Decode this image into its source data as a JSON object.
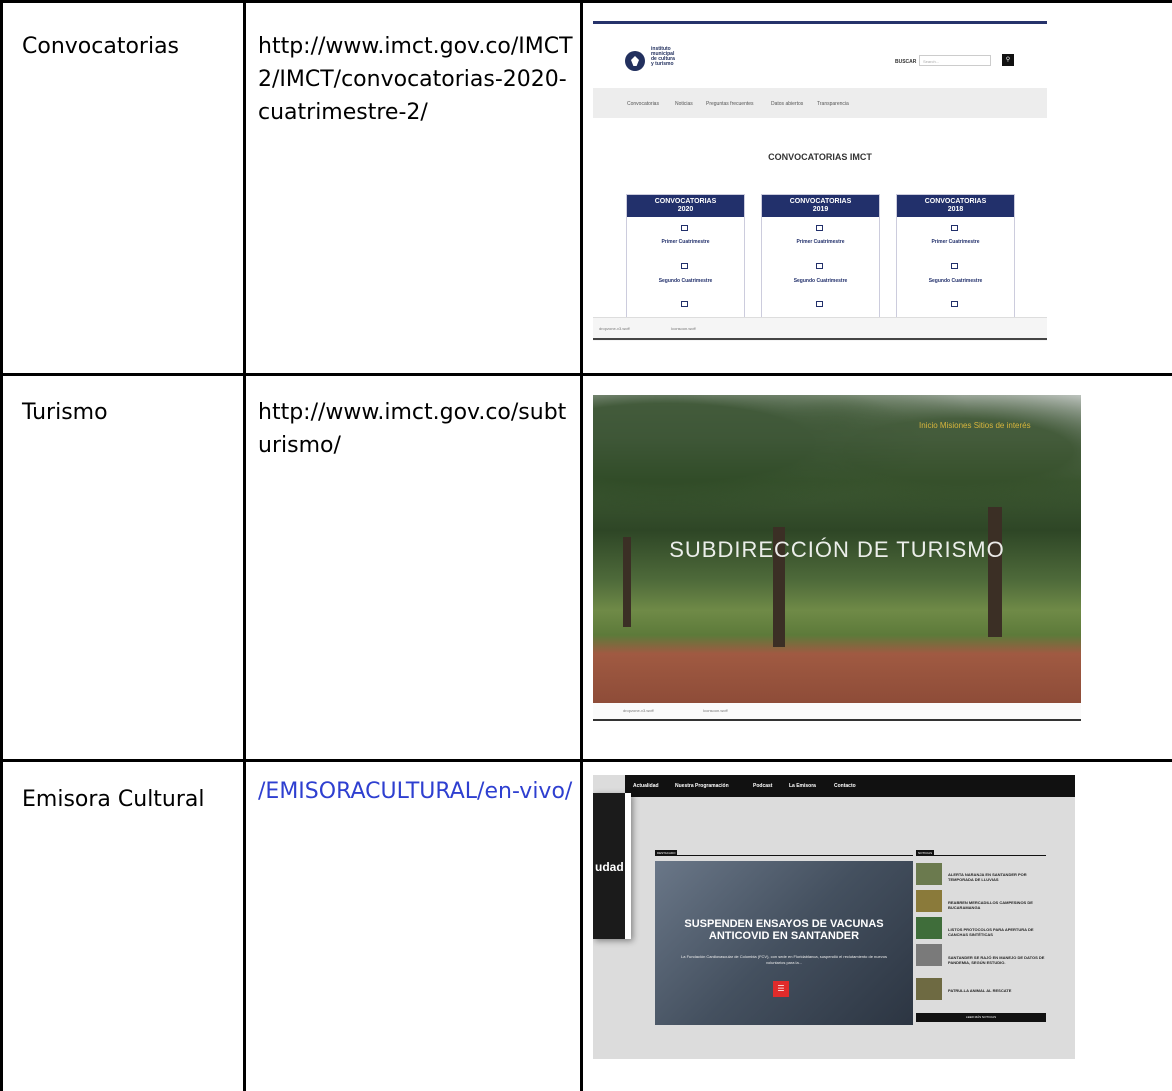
{
  "rows": [
    {
      "name": "Convocatorias",
      "url": "http://www.imct.gov.co/IMCT2/IMCT/convocatorias-2020-cuatrimestre-2/",
      "url_is_link": false
    },
    {
      "name": "Turismo",
      "url": "http://www.imct.gov.co/subturismo/",
      "url_is_link": false
    },
    {
      "name": "Emisora Cultural",
      "url": "/EMISORACULTURAL/en-vivo/",
      "url_is_link": true
    }
  ],
  "shot1": {
    "logo_lines": [
      "instituto",
      "municipal",
      "de cultura",
      "y turismo"
    ],
    "search_label": "BUSCAR",
    "search_placeholder": "Search...",
    "nav": [
      "Convocatorias",
      "Noticias",
      "Preguntas frecuentes",
      "Datos abiertos",
      "Transparencia"
    ],
    "heading": "CONVOCATORIAS IMCT",
    "cards": [
      {
        "title_line1": "CONVOCATORIAS",
        "title_line2": "2020",
        "items": [
          "Primer Cuatrimestre",
          "Segundo Cuatrimestre"
        ]
      },
      {
        "title_line1": "CONVOCATORIAS",
        "title_line2": "2019",
        "items": [
          "Primer Cuatrimestre",
          "Segundo Cuatrimestre"
        ]
      },
      {
        "title_line1": "CONVOCATORIAS",
        "title_line2": "2018",
        "items": [
          "Primer Cuatrimestre",
          "Segundo Cuatrimestre"
        ]
      }
    ],
    "downloads": [
      "dropzone-v3.woff",
      "Iconsoon.woff"
    ]
  },
  "shot2": {
    "title": "SUBDIRECCIÓN DE TURISMO",
    "nav": "Inicio    Misiones    Sitios de interés",
    "downloads": [
      "dropzone-v3.woff",
      "Iconsoon.woff"
    ]
  },
  "shot3": {
    "nav": [
      "Actualidad",
      "Nuestra Programación",
      "Podcast",
      "La Emisora",
      "Contacto"
    ],
    "side_text": "udad",
    "destacado_label": "DESTACADO",
    "noticias_label": "NOTICIAS",
    "feature_title": "SUSPENDEN ENSAYOS DE VACUNAS ANTICOVID EN SANTANDER",
    "feature_body": "La Fundación Cardiovascular de Colombia (FCV), con sede en Floridablanca, suspendió el reclutamiento de nuevos voluntarios para la...",
    "news": [
      "ALERTA NARANJA EN SANTANDER POR TEMPORADA DE LLUVIAS",
      "REABREN MERCADILLOS CAMPESINOS DE BUCARAMANGA",
      "LISTOS PROTOCOLOS PARA APERTURA DE CANCHAS SINTÉTICAS",
      "SANTANDER SE RAJÓ EN MANEJO DE DATOS DE PANDEMIA, SEGÚN ESTUDIO.",
      "PATRULLA ANIMAL AL RESCATE"
    ],
    "more_label": "LEER MÁS NOTICIAS"
  }
}
